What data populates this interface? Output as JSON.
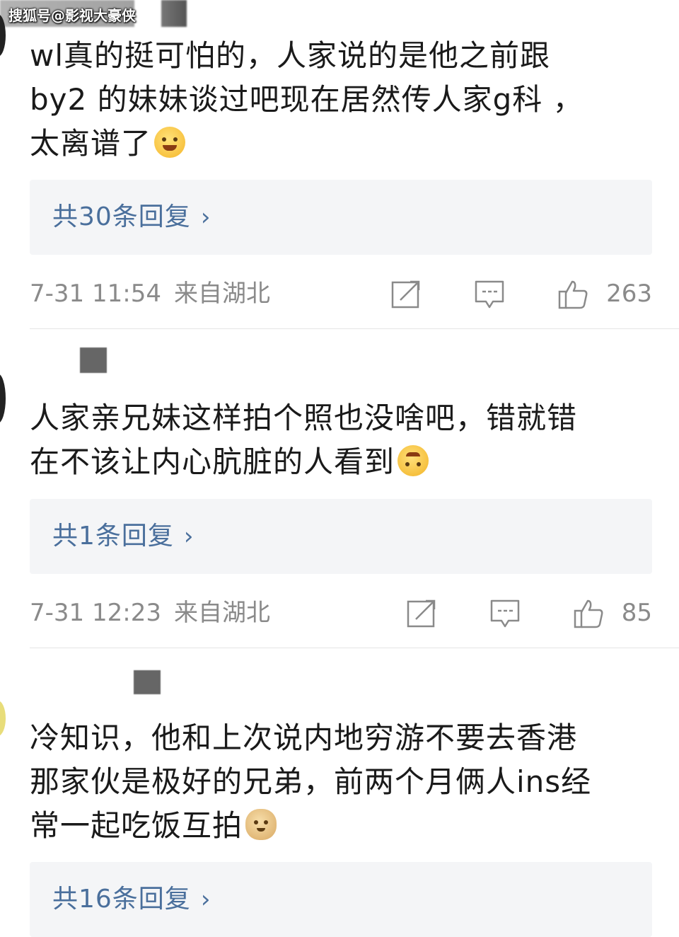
{
  "watermark": "搜狐号@影视大豪侠",
  "comments": [
    {
      "text": "wl真的挺可怕的，人家说的是他之前跟\nby2 的妹妹谈过吧现在居然传人家g科  ，\n太离谱了",
      "emoji": "crying-laughing-emoji",
      "replies_label": "共30条回复",
      "time": "7-31 11:54",
      "place": "来自湖北",
      "likes": "263"
    },
    {
      "text": "人家亲兄妹这样拍个照也没啥吧，错就错\n在不该让内心肮脏的人看到",
      "emoji": "upside-down-face-emoji",
      "replies_label": "共1条回复",
      "time": "7-31 12:23",
      "place": "来自湖北",
      "likes": "85"
    },
    {
      "text": "冷知识，他和上次说内地穷游不要去香港\n那家伙是极好的兄弟，前两个月俩人ins经\n常一起吃饭互拍",
      "emoji": "doge-emoji",
      "replies_label": "共16条回复"
    }
  ],
  "icons": {
    "share": "share-icon",
    "comment": "comment-icon",
    "like": "thumbs-up-icon",
    "chevron": "chevron-right-icon"
  },
  "colors": {
    "link": "#4a6f9c",
    "meta": "#8a8a8a",
    "reply_bg": "#f4f5f7"
  }
}
